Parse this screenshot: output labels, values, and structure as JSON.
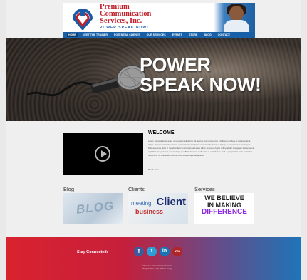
{
  "header": {
    "brand_line1": "Premium",
    "brand_line2": "Communication",
    "brand_line3": "Services, Inc.",
    "tagline": "POWER SPEAK NOW!"
  },
  "nav": {
    "items": [
      "HOME",
      "MEET THE TRAINER",
      "POTENTIAL CLIENTS",
      "OUR SERVICES",
      "EVENTS",
      "STORE",
      "BLOG",
      "CONTACT"
    ],
    "active_index": 0
  },
  "hero": {
    "line1": "POWER",
    "line2": "SPEAK NOW!"
  },
  "welcome": {
    "title": "WELCOME",
    "body": "Lorem ipsum dolor sit amet, consectetur adipiscing elit, sed do eiusmod tempor incididunt ut labore et dolore magna aliqua. Ut enim ad minim veniam, quis nostrud exercitation ullamco laboris nisi ut aliquip ex ea commodo consequat. Duis aute irure dolor in reprehenderit in voluptate velit esse cillum dolore eu fugiat nulla pariatur. Excepteur sint occaecat cupidatat non proident, sunt in culpa qui officia deserunt mollit anim id est laborum. Sed ut perspiciatis unde omnis iste natus error sit voluptatem accusantium doloremque laudantium.",
    "read_more": "Read more"
  },
  "sections": {
    "blog": {
      "title": "Blog",
      "image_word": "BLOG"
    },
    "clients": {
      "title": "Clients",
      "img_client": "Client",
      "img_meeting": "meeting",
      "img_business": "business"
    },
    "services": {
      "title": "Services",
      "img_line1": "WE BELIEVE",
      "img_line2": "IN MAKING",
      "img_line3": "DIFFERENCE"
    }
  },
  "footer": {
    "stay_connected": "Stay Connected:",
    "social": [
      {
        "icon": "facebook-icon",
        "glyph": "f"
      },
      {
        "icon": "twitter-icon",
        "glyph": "t"
      },
      {
        "icon": "linkedin-icon",
        "glyph": "in"
      },
      {
        "icon": "youtube-icon",
        "glyph": "You"
      }
    ],
    "copy_line1": "© Premium Communication Services",
    "copy_line2": "All Rights Reserved | Website Design"
  },
  "colors": {
    "nav_bg": "#1760a8",
    "brand_red": "#c0202c",
    "footer_start": "#d9232e",
    "footer_end": "#1e74b8"
  }
}
